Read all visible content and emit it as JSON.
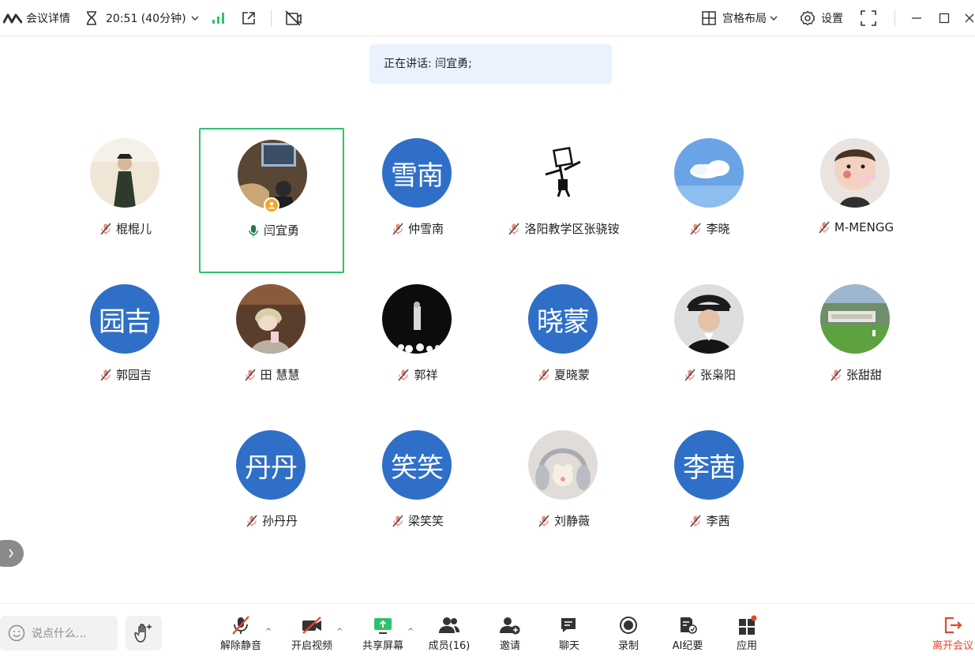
{
  "topbar": {
    "meeting_details": "会议详情",
    "time": "20:51 (40分钟)",
    "layout_label": "宫格布局",
    "settings_label": "设置"
  },
  "speaking": {
    "label": "正在讲话: 闫宜勇;"
  },
  "participants": [
    {
      "name": "棍棍儿",
      "avatar_text": "",
      "muted": true
    },
    {
      "name": "闫宜勇",
      "avatar_text": "",
      "muted": false,
      "host": true,
      "active": true
    },
    {
      "name": "仲雪南",
      "avatar_text": "雪南",
      "muted": true
    },
    {
      "name": "洛阳教学区张骁铵",
      "avatar_text": "",
      "muted": true
    },
    {
      "name": "李晓",
      "avatar_text": "",
      "muted": true
    },
    {
      "name": "M-MENGG",
      "avatar_text": "",
      "muted": true
    },
    {
      "name": "郭园吉",
      "avatar_text": "园吉",
      "muted": true
    },
    {
      "name": "田 慧慧",
      "avatar_text": "",
      "muted": true
    },
    {
      "name": "郭祥",
      "avatar_text": "",
      "muted": true
    },
    {
      "name": "夏晓蒙",
      "avatar_text": "晓蒙",
      "muted": true
    },
    {
      "name": "张枭阳",
      "avatar_text": "",
      "muted": true
    },
    {
      "name": "张甜甜",
      "avatar_text": "",
      "muted": true
    },
    {
      "name": "孙丹丹",
      "avatar_text": "丹丹",
      "muted": true
    },
    {
      "name": "梁笑笑",
      "avatar_text": "笑笑",
      "muted": true
    },
    {
      "name": "刘静薇",
      "avatar_text": "",
      "muted": true
    },
    {
      "name": "李茜",
      "avatar_text": "李茜",
      "muted": true
    }
  ],
  "bottombar": {
    "chat_placeholder": "说点什么...",
    "unmute": "解除静音",
    "video": "开启视频",
    "share": "共享屏幕",
    "members": "成员(16)",
    "invite": "邀请",
    "chat": "聊天",
    "record": "录制",
    "ai_notes": "AI纪要",
    "apps": "应用",
    "leave": "离开会议"
  },
  "colors": {
    "accent_green": "#2ec26a",
    "avatar_blue": "#2f6fc8",
    "leave_red": "#e8452c",
    "speaking_bg": "#eaf2fe"
  }
}
